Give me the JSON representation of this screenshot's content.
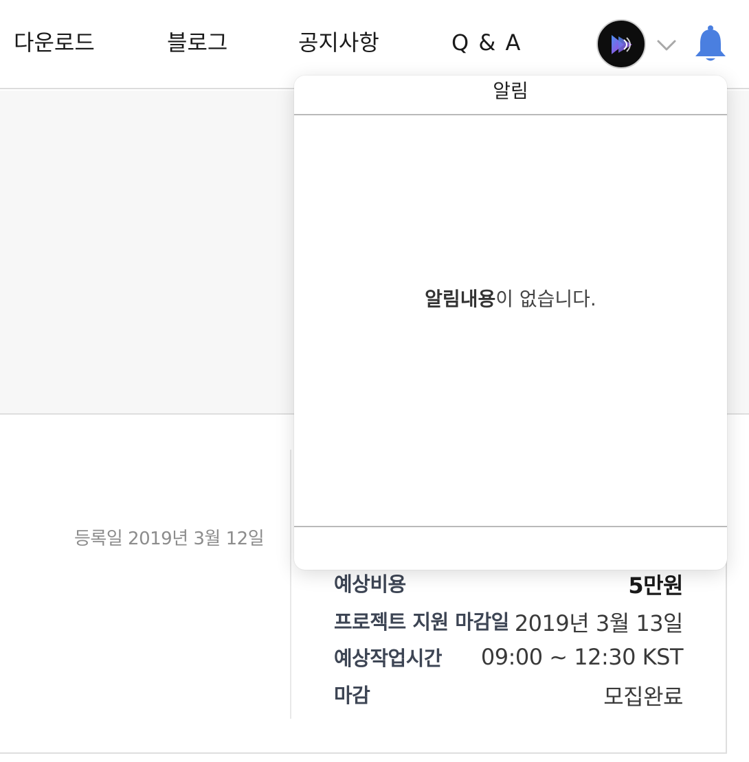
{
  "nav": {
    "download": "다운로드",
    "blog": "블로그",
    "notice": "공지사항",
    "qa": "Q & A"
  },
  "header_icons": {
    "avatar": "app-logo-avatar",
    "dropdown": "chevron-down-icon",
    "notifications": "bell-icon",
    "bell_color": "#4a7fe0"
  },
  "notifications": {
    "title": "알림",
    "empty_bold": "알림내용",
    "empty_rest": "이 없습니다."
  },
  "project": {
    "registered": "등록일 2019년 3월 12일",
    "details": [
      {
        "label": "예상비용",
        "value": "5만원"
      },
      {
        "label": "프로젝트 지원 마감일",
        "value": "2019년 3월 13일"
      },
      {
        "label": "예상작업시간",
        "value": "09:00 ~ 12:30 KST"
      },
      {
        "label": "마감",
        "value": "모집완료"
      }
    ]
  }
}
